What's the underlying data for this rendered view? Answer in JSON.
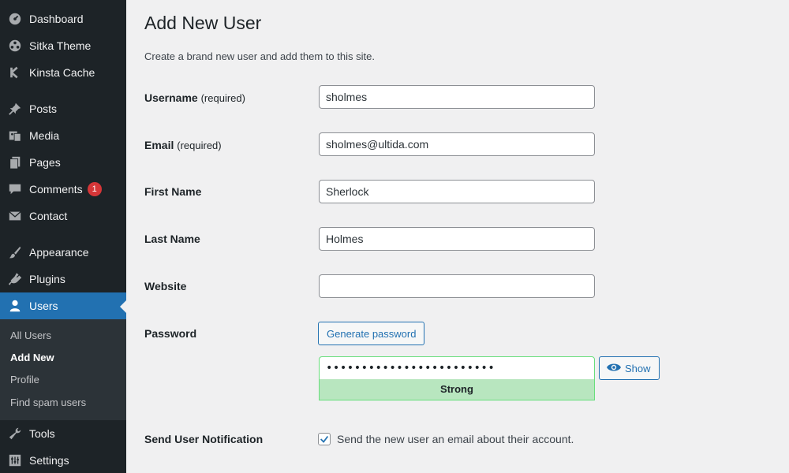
{
  "sidebar": {
    "items": [
      {
        "label": "Dashboard",
        "icon": "dashboard-icon"
      },
      {
        "label": "Sitka Theme",
        "icon": "sitka-theme-icon"
      },
      {
        "label": "Kinsta Cache",
        "icon": "kinsta-icon"
      },
      {
        "label": "Posts",
        "icon": "pin-icon"
      },
      {
        "label": "Media",
        "icon": "media-icon"
      },
      {
        "label": "Pages",
        "icon": "pages-icon"
      },
      {
        "label": "Comments",
        "icon": "comment-icon",
        "badge": "1"
      },
      {
        "label": "Contact",
        "icon": "mail-icon"
      },
      {
        "label": "Appearance",
        "icon": "paintbrush-icon"
      },
      {
        "label": "Plugins",
        "icon": "plugin-icon"
      },
      {
        "label": "Users",
        "icon": "user-icon"
      },
      {
        "label": "Tools",
        "icon": "wrench-icon"
      },
      {
        "label": "Settings",
        "icon": "settings-icon"
      }
    ],
    "submenu": [
      "All Users",
      "Add New",
      "Profile",
      "Find spam users"
    ],
    "active": "Users",
    "active_sub": "Add New"
  },
  "page": {
    "title": "Add New User",
    "description": "Create a brand new user and add them to this site."
  },
  "form": {
    "username": {
      "label": "Username",
      "required": "(required)",
      "value": "sholmes"
    },
    "email": {
      "label": "Email",
      "required": "(required)",
      "value": "sholmes@ultida.com"
    },
    "first_name": {
      "label": "First Name",
      "value": "Sherlock"
    },
    "last_name": {
      "label": "Last Name",
      "value": "Holmes"
    },
    "website": {
      "label": "Website",
      "value": ""
    },
    "password": {
      "label": "Password",
      "generate_label": "Generate password",
      "value": "••••••••••••••••••••••••",
      "strength": "Strong",
      "show_label": "Show"
    },
    "notification": {
      "label": "Send User Notification",
      "checked": true,
      "text": "Send the new user an email about their account."
    }
  },
  "colors": {
    "sidebar_bg": "#1d2327",
    "active": "#2271b1",
    "badge": "#d63638",
    "strong_bg": "#b8e6bf",
    "strong_border": "#68de7c"
  }
}
